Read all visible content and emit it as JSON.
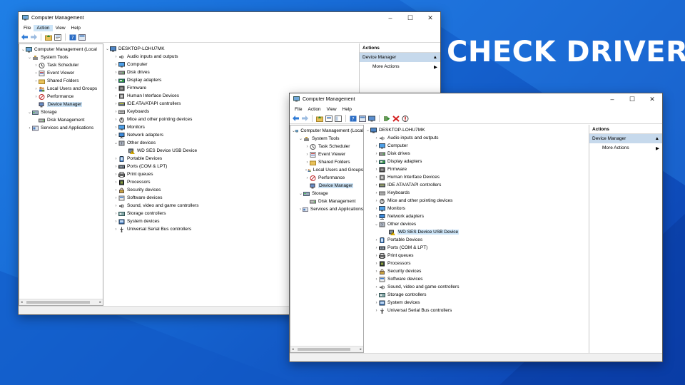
{
  "headline": "CHECK DRIVER",
  "colors": {
    "background": "#1563cf",
    "selection": "#cce4f7",
    "actions_header": "#c6d9ec"
  },
  "window": {
    "title": "Computer Management",
    "controls": [
      "–",
      "☐",
      "✕"
    ],
    "menu": [
      "File",
      "Action",
      "View",
      "Help"
    ],
    "toolbar_icons": [
      "back-arrow-icon",
      "forward-arrow-icon",
      "up-folder-icon",
      "properties-icon",
      "help-icon",
      "console-icon"
    ],
    "toolbar_icons_extra": [
      "update-driver-icon",
      "uninstall-icon",
      "disable-icon"
    ]
  },
  "left_tree": {
    "root": "Computer Management (Local",
    "items": [
      {
        "label": "System Tools",
        "level": 1,
        "expander": "v",
        "icon": "tools-icon"
      },
      {
        "label": "Task Scheduler",
        "level": 2,
        "expander": ">",
        "icon": "clock-icon"
      },
      {
        "label": "Event Viewer",
        "level": 2,
        "expander": ">",
        "icon": "event-icon"
      },
      {
        "label": "Shared Folders",
        "level": 2,
        "expander": ">",
        "icon": "folder-icon"
      },
      {
        "label": "Local Users and Groups",
        "level": 2,
        "expander": ">",
        "icon": "users-icon"
      },
      {
        "label": "Performance",
        "level": 2,
        "expander": ">",
        "icon": "no-entry-icon"
      },
      {
        "label": "Device Manager",
        "level": 2,
        "expander": "",
        "icon": "device-manager-icon",
        "selected": true
      },
      {
        "label": "Storage",
        "level": 1,
        "expander": "v",
        "icon": "storage-icon"
      },
      {
        "label": "Disk Management",
        "level": 2,
        "expander": "",
        "icon": "disk-icon"
      },
      {
        "label": "Services and Applications",
        "level": 1,
        "expander": ">",
        "icon": "services-icon"
      }
    ]
  },
  "device_tree": {
    "root": "DESKTOP-LOHU7MK",
    "items": [
      {
        "label": "Audio inputs and outputs",
        "expander": ">",
        "icon": "speaker-icon"
      },
      {
        "label": "Computer",
        "expander": ">",
        "icon": "monitor-icon"
      },
      {
        "label": "Disk drives",
        "expander": ">",
        "icon": "disk-drive-icon"
      },
      {
        "label": "Display adapters",
        "expander": ">",
        "icon": "display-adapter-icon"
      },
      {
        "label": "Firmware",
        "expander": ">",
        "icon": "firmware-icon"
      },
      {
        "label": "Human Interface Devices",
        "expander": ">",
        "icon": "hid-icon"
      },
      {
        "label": "IDE ATA/ATAPI controllers",
        "expander": ">",
        "icon": "ide-icon"
      },
      {
        "label": "Keyboards",
        "expander": ">",
        "icon": "keyboard-icon"
      },
      {
        "label": "Mice and other pointing devices",
        "expander": ">",
        "icon": "mouse-icon"
      },
      {
        "label": "Monitors",
        "expander": ">",
        "icon": "monitor-icon"
      },
      {
        "label": "Network adapters",
        "expander": ">",
        "icon": "network-icon"
      },
      {
        "label": "Other devices",
        "expander": "v",
        "icon": "other-devices-icon"
      },
      {
        "label": "WD SES Device USB Device",
        "expander": "",
        "icon": "warning-device-icon",
        "child": true
      },
      {
        "label": "Portable Devices",
        "expander": ">",
        "icon": "portable-icon"
      },
      {
        "label": "Ports (COM & LPT)",
        "expander": ">",
        "icon": "ports-icon"
      },
      {
        "label": "Print queues",
        "expander": ">",
        "icon": "printer-icon"
      },
      {
        "label": "Processors",
        "expander": ">",
        "icon": "processor-icon"
      },
      {
        "label": "Security devices",
        "expander": ">",
        "icon": "security-icon"
      },
      {
        "label": "Software devices",
        "expander": ">",
        "icon": "software-icon"
      },
      {
        "label": "Sound, video and game controllers",
        "expander": ">",
        "icon": "sound-icon"
      },
      {
        "label": "Storage controllers",
        "expander": ">",
        "icon": "storage-controller-icon"
      },
      {
        "label": "System devices",
        "expander": ">",
        "icon": "system-icon"
      },
      {
        "label": "Universal Serial Bus controllers",
        "expander": ">",
        "icon": "usb-icon"
      }
    ]
  },
  "actions": {
    "header": "Actions",
    "section": "Device Manager",
    "more": "More Actions"
  }
}
